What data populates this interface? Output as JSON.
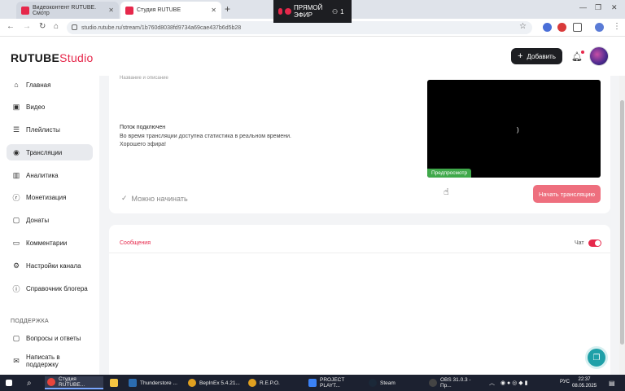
{
  "browser": {
    "tabs": [
      {
        "title": "Видеоконтент RUTUBE. Смотр"
      },
      {
        "title": "Студия RUTUBE"
      }
    ],
    "url": "studio.rutube.ru/stream/1b760d8038fd9734a69cae437b6d5b28",
    "live_pill": {
      "label": "ПРЯМОЙ ЭФИР",
      "viewers": "1"
    }
  },
  "header": {
    "logo_main": "RUTUBE",
    "logo_studio": "Studio",
    "add_button": "Добавить"
  },
  "sidebar": {
    "items": [
      {
        "label": "Главная",
        "icon": "home-icon"
      },
      {
        "label": "Видео",
        "icon": "video-icon"
      },
      {
        "label": "Плейлисты",
        "icon": "playlist-icon"
      },
      {
        "label": "Трансляции",
        "icon": "broadcast-icon"
      },
      {
        "label": "Аналитика",
        "icon": "analytics-icon"
      },
      {
        "label": "Монетизация",
        "icon": "monetization-icon"
      },
      {
        "label": "Донаты",
        "icon": "donation-icon"
      },
      {
        "label": "Комментарии",
        "icon": "comment-icon"
      },
      {
        "label": "Настройки канала",
        "icon": "gear-icon"
      },
      {
        "label": "Справочник блогера",
        "icon": "info-icon"
      }
    ],
    "support_heading": "ПОДДЕРЖКА",
    "support_items": [
      {
        "label": "Вопросы и ответы",
        "icon": "faq-icon"
      },
      {
        "label": "Написать в поддержку",
        "icon": "mail-icon"
      }
    ],
    "active_index": 3
  },
  "stream": {
    "desc_label": "Название и описание",
    "status": "Поток подключен",
    "info": "Во время трансляции доступна статистика в реальном времени.",
    "wish": "Хорошего эфира!",
    "ready": "Можно начинать",
    "preview_badge": "Предпросмотр",
    "start_button": "Начать трансляцию"
  },
  "chat": {
    "tab": "Сообщения",
    "toggle_label": "Чат",
    "toggle_on": true
  },
  "taskbar": {
    "items": [
      {
        "label": "Студия RUTUBE...",
        "color": "#e8453c"
      },
      {
        "label": "",
        "color": "#f5c542"
      },
      {
        "label": "Thunderstore ...",
        "color": "#2b6cb0"
      },
      {
        "label": "BepInEx 5.4.21...",
        "color": "#e0a020"
      },
      {
        "label": "R.E.P.O.",
        "color": "#e0a020"
      },
      {
        "label": "PROJECT PLAYT...",
        "color": "#3b82f6"
      },
      {
        "label": "Steam",
        "color": "#1b2838"
      },
      {
        "label": "OBS 31.0.3 - Пр...",
        "color": "#444"
      }
    ],
    "lang": "РУС",
    "time": "22:37",
    "date": "08.05.2025"
  },
  "colors": {
    "accent": "#e6284b",
    "success": "#3fa84a",
    "start_button": "#ee6f7e"
  }
}
